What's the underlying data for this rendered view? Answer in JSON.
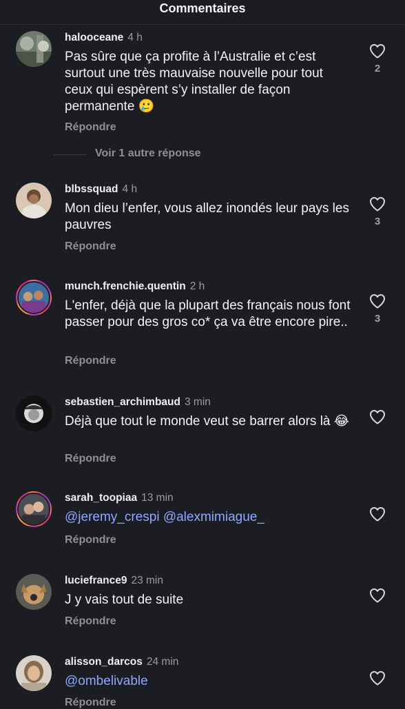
{
  "header": {
    "title": "Commentaires"
  },
  "reply_label": "Répondre",
  "comments": [
    {
      "username": "halooceane",
      "time": "4 h",
      "text": "Pas sûre que ça profite à l’Australie et c’est surtout une très mauvaise nouvelle pour tout ceux qui espèrent s’y installer de façon permanente 🥲",
      "likes": "2",
      "more_replies": "Voir 1 autre réponse"
    },
    {
      "username": "blbssquad",
      "time": "4 h",
      "text": "Mon dieu l’enfer, vous allez inondés leur pays les pauvres",
      "likes": "3"
    },
    {
      "username": "munch.frenchie.quentin",
      "time": "2 h",
      "text": "L'enfer, déjà que la plupart des français nous font passer pour des gros co* ça va être encore pire..",
      "likes": "3"
    },
    {
      "username": "sebastien_archimbaud",
      "time": "3 min",
      "text": "Déjà que tout le monde veut se barrer alors là 😂",
      "likes": ""
    },
    {
      "username": "sarah_toopiaa",
      "time": "13 min",
      "mention1": "@jeremy_crespi",
      "mention2": "@alexmimiague_",
      "likes": ""
    },
    {
      "username": "luciefrance9",
      "time": "23 min",
      "text": "J y vais tout de suite",
      "likes": ""
    },
    {
      "username": "alisson_darcos",
      "time": "24 min",
      "mention1": "@ombelivable",
      "likes": ""
    }
  ]
}
